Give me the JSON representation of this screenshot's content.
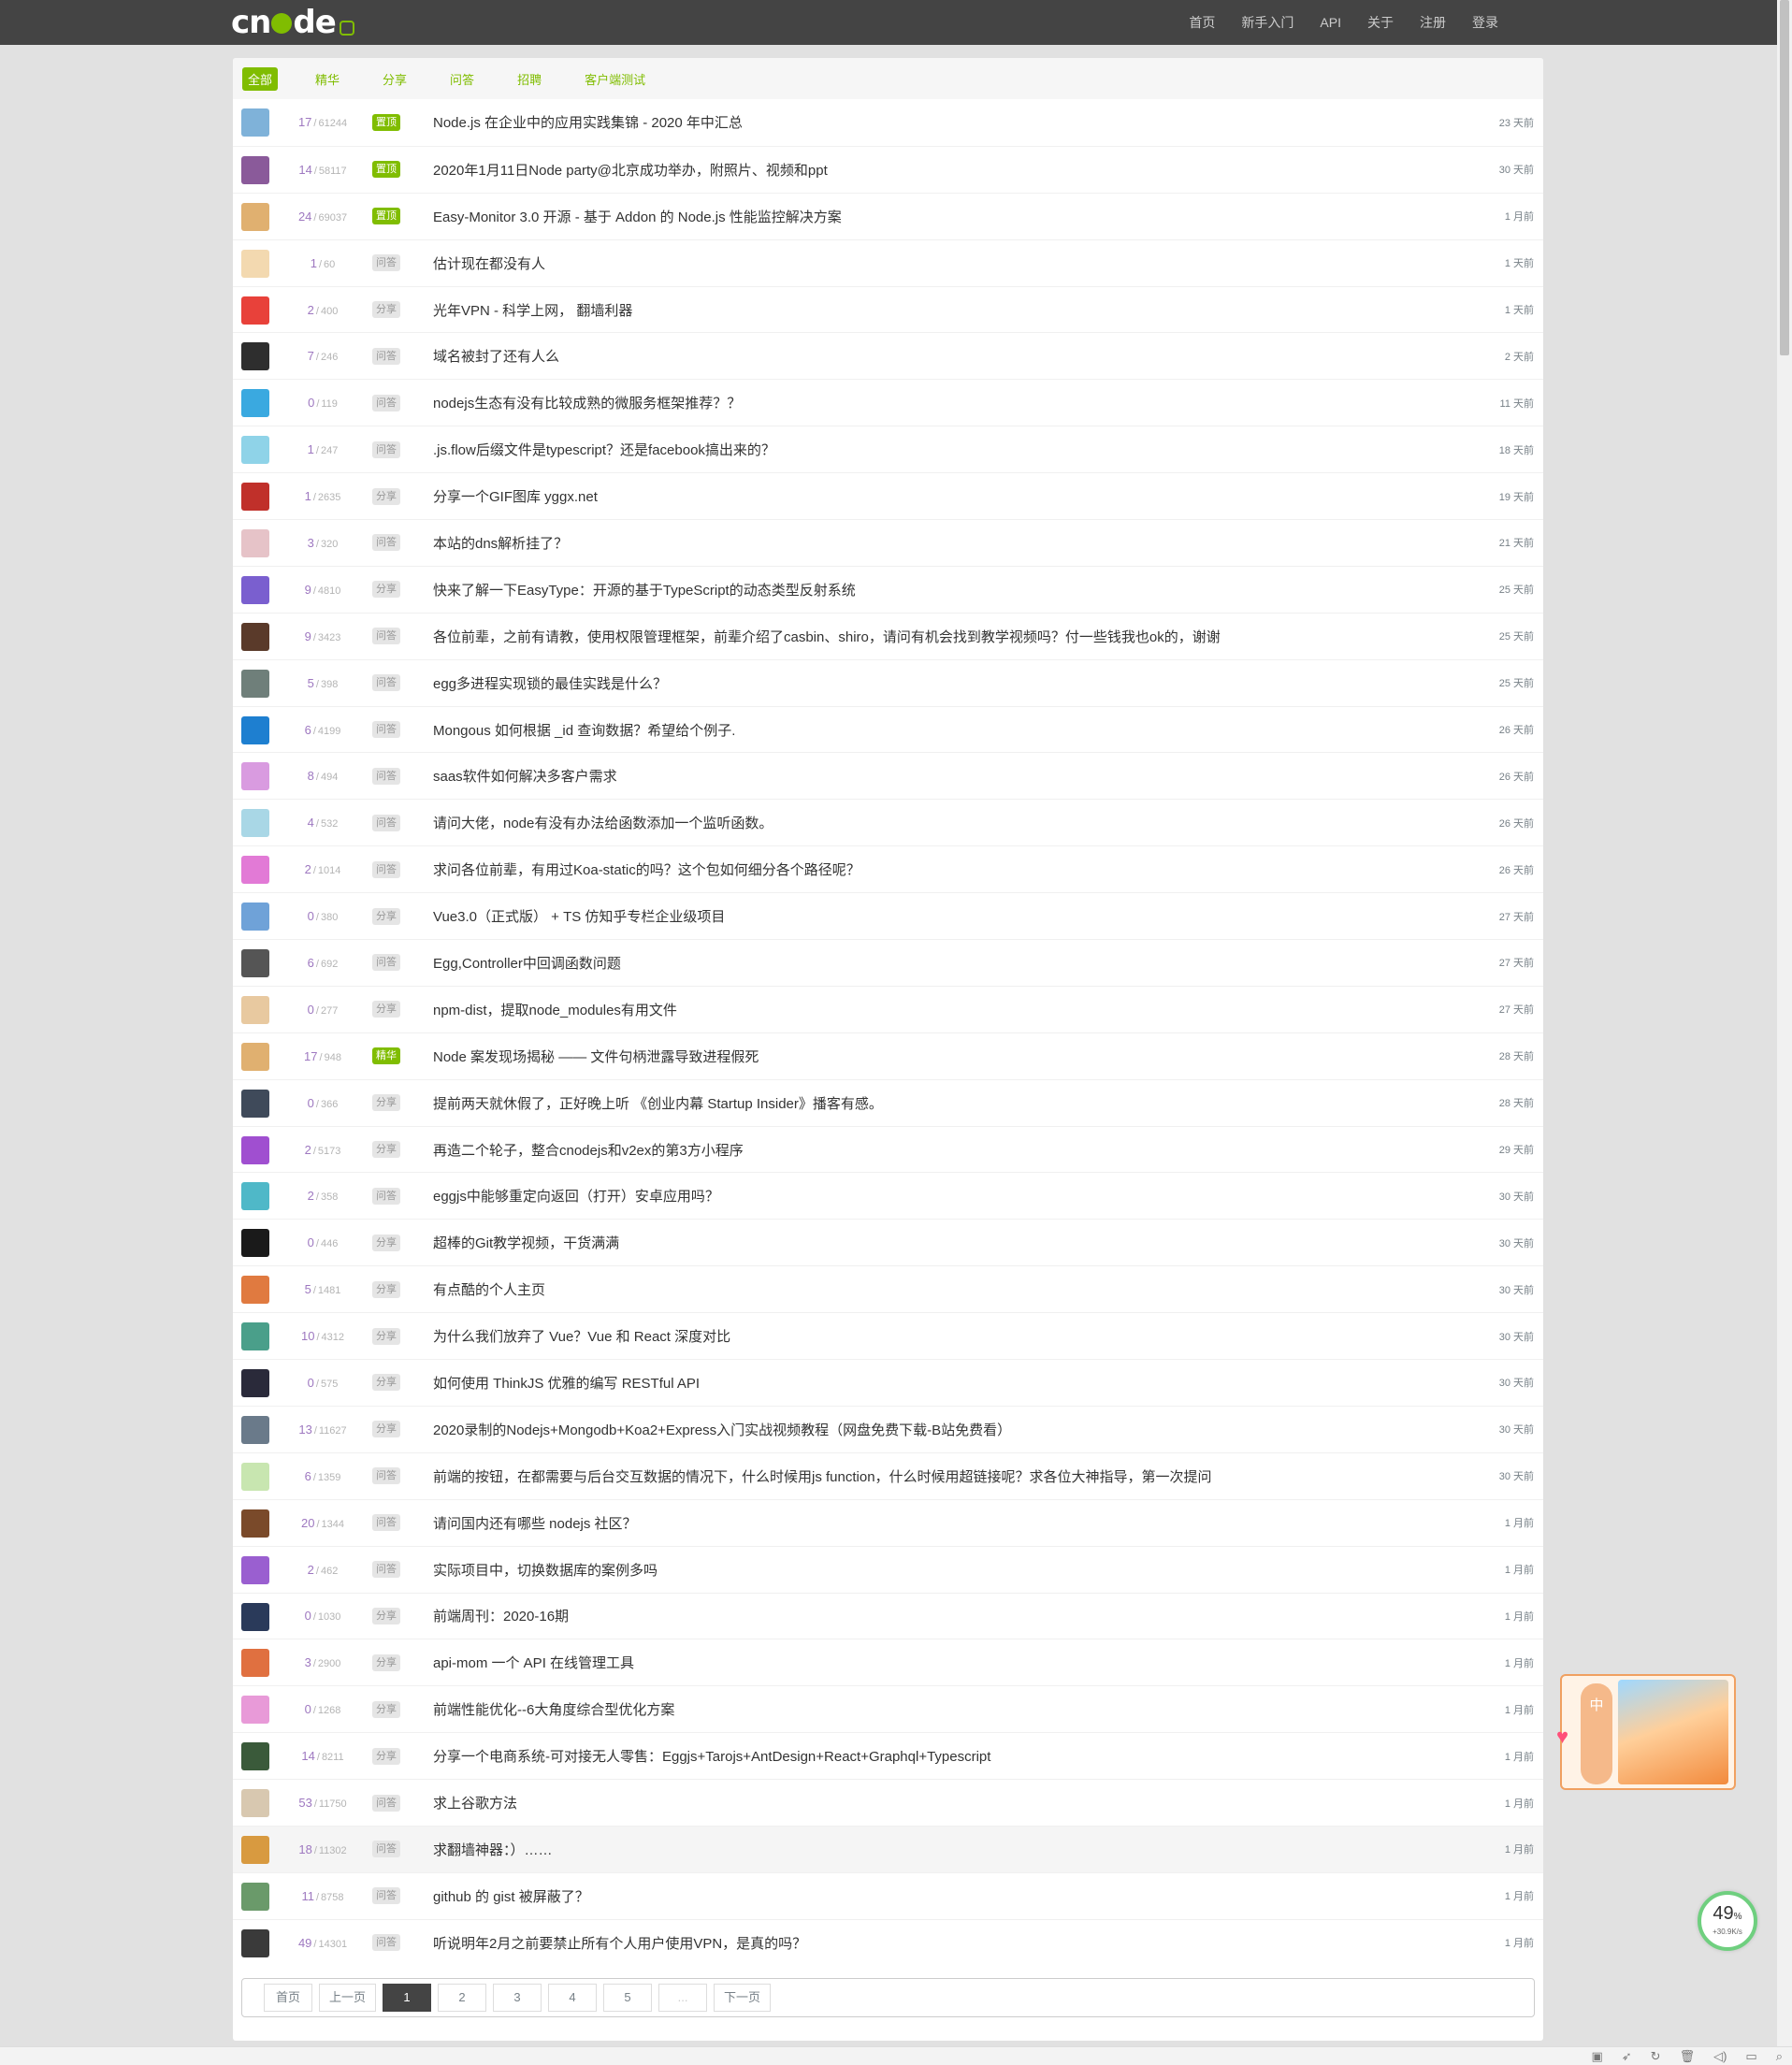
{
  "nav": {
    "brand": "cnode",
    "links": [
      "首页",
      "新手入门",
      "API",
      "关于",
      "注册",
      "登录"
    ]
  },
  "tabs": [
    "全部",
    "精华",
    "分享",
    "问答",
    "招聘",
    "客户端测试"
  ],
  "topics": [
    {
      "replies": "17",
      "visits": "61244",
      "badge": "置顶",
      "badge_type": "top",
      "title": "Node.js 在企业中的应用实践集锦 - 2020 年中汇总",
      "ago": "23 天前",
      "avatar_color": "#7fb2d9"
    },
    {
      "replies": "14",
      "visits": "58117",
      "badge": "置顶",
      "badge_type": "top",
      "title": "2020年1月11日Node party@北京成功举办，附照片、视频和ppt",
      "ago": "30 天前",
      "avatar_color": "#8a5a9a"
    },
    {
      "replies": "24",
      "visits": "69037",
      "badge": "置顶",
      "badge_type": "top",
      "title": "Easy-Monitor 3.0 开源 - 基于 Addon 的 Node.js 性能监控解决方案",
      "ago": "1 月前",
      "avatar_color": "#e0b070"
    },
    {
      "replies": "1",
      "visits": "60",
      "badge": "问答",
      "badge_type": "plain",
      "title": "估计现在都没有人",
      "ago": "1 天前",
      "avatar_color": "#f3d9b0"
    },
    {
      "replies": "2",
      "visits": "400",
      "badge": "分享",
      "badge_type": "plain",
      "title": "光年VPN - 科学上网， 翻墙利器",
      "ago": "1 天前",
      "avatar_color": "#e8413a"
    },
    {
      "replies": "7",
      "visits": "246",
      "badge": "问答",
      "badge_type": "plain",
      "title": "域名被封了还有人么",
      "ago": "2 天前",
      "avatar_color": "#2e2e2e"
    },
    {
      "replies": "0",
      "visits": "119",
      "badge": "问答",
      "badge_type": "plain",
      "title": "nodejs生态有没有比较成熟的微服务框架推荐？？",
      "ago": "11 天前",
      "avatar_color": "#3aa9e0"
    },
    {
      "replies": "1",
      "visits": "247",
      "badge": "问答",
      "badge_type": "plain",
      "title": ".js.flow后缀文件是typescript？还是facebook搞出来的？",
      "ago": "18 天前",
      "avatar_color": "#8fd3e8"
    },
    {
      "replies": "1",
      "visits": "2635",
      "badge": "分享",
      "badge_type": "plain",
      "title": "分享一个GIF图库 yggx.net",
      "ago": "19 天前",
      "avatar_color": "#c0302a"
    },
    {
      "replies": "3",
      "visits": "320",
      "badge": "问答",
      "badge_type": "plain",
      "title": "本站的dns解析挂了？",
      "ago": "21 天前",
      "avatar_color": "#e6c3c8"
    },
    {
      "replies": "9",
      "visits": "4810",
      "badge": "分享",
      "badge_type": "plain",
      "title": "快来了解一下EasyType：开源的基于TypeScript的动态类型反射系统",
      "ago": "25 天前",
      "avatar_color": "#7a5fcf"
    },
    {
      "replies": "9",
      "visits": "3423",
      "badge": "问答",
      "badge_type": "plain",
      "title": "各位前辈，之前有请教，使用权限管理框架，前辈介绍了casbin、shiro，请问有机会找到教学视频吗？付一些钱我也ok的，谢谢",
      "ago": "25 天前",
      "avatar_color": "#5a3a2a"
    },
    {
      "replies": "5",
      "visits": "398",
      "badge": "问答",
      "badge_type": "plain",
      "title": "egg多进程实现锁的最佳实践是什么？",
      "ago": "25 天前",
      "avatar_color": "#6f7f7a"
    },
    {
      "replies": "6",
      "visits": "4199",
      "badge": "问答",
      "badge_type": "plain",
      "title": "Mongous 如何根据 _id 查询数据？希望给个例子.",
      "ago": "26 天前",
      "avatar_color": "#1e7fd0"
    },
    {
      "replies": "8",
      "visits": "494",
      "badge": "问答",
      "badge_type": "plain",
      "title": "saas软件如何解决多客户需求",
      "ago": "26 天前",
      "avatar_color": "#d99be0"
    },
    {
      "replies": "4",
      "visits": "532",
      "badge": "问答",
      "badge_type": "plain",
      "title": "请问大佬，node有没有办法给函数添加一个监听函数。",
      "ago": "26 天前",
      "avatar_color": "#a9d7e6"
    },
    {
      "replies": "2",
      "visits": "1014",
      "badge": "问答",
      "badge_type": "plain",
      "title": "求问各位前辈，有用过Koa-static的吗？这个包如何细分各个路径呢？",
      "ago": "26 天前",
      "avatar_color": "#e27ad6"
    },
    {
      "replies": "0",
      "visits": "380",
      "badge": "分享",
      "badge_type": "plain",
      "title": "Vue3.0（正式版） + TS 仿知乎专栏企业级项目",
      "ago": "27 天前",
      "avatar_color": "#6fa2d8"
    },
    {
      "replies": "6",
      "visits": "692",
      "badge": "问答",
      "badge_type": "plain",
      "title": "Egg,Controller中回调函数问题",
      "ago": "27 天前",
      "avatar_color": "#555555"
    },
    {
      "replies": "0",
      "visits": "277",
      "badge": "分享",
      "badge_type": "plain",
      "title": "npm-dist，提取node_modules有用文件",
      "ago": "27 天前",
      "avatar_color": "#e8c9a0"
    },
    {
      "replies": "17",
      "visits": "948",
      "badge": "精华",
      "badge_type": "top",
      "title": "Node 案发现场揭秘 —— 文件句柄泄露导致进程假死",
      "ago": "28 天前",
      "avatar_color": "#e0b070"
    },
    {
      "replies": "0",
      "visits": "366",
      "badge": "分享",
      "badge_type": "plain",
      "title": "提前两天就休假了，正好晚上听 《创业内幕 Startup Insider》播客有感。",
      "ago": "28 天前",
      "avatar_color": "#3f4a5a"
    },
    {
      "replies": "2",
      "visits": "5173",
      "badge": "分享",
      "badge_type": "plain",
      "title": "再造二个轮子，整合cnodejs和v2ex的第3方小程序",
      "ago": "29 天前",
      "avatar_color": "#a04fd0"
    },
    {
      "replies": "2",
      "visits": "358",
      "badge": "问答",
      "badge_type": "plain",
      "title": "eggjs中能够重定向返回（打开）安卓应用吗？",
      "ago": "30 天前",
      "avatar_color": "#4fb8c8"
    },
    {
      "replies": "0",
      "visits": "446",
      "badge": "分享",
      "badge_type": "plain",
      "title": "超棒的Git教学视频，干货满满",
      "ago": "30 天前",
      "avatar_color": "#1a1a1a"
    },
    {
      "replies": "5",
      "visits": "1481",
      "badge": "分享",
      "badge_type": "plain",
      "title": "有点酷的个人主页",
      "ago": "30 天前",
      "avatar_color": "#e07a40"
    },
    {
      "replies": "10",
      "visits": "4312",
      "badge": "分享",
      "badge_type": "plain",
      "title": "为什么我们放弃了 Vue？Vue 和 React 深度对比",
      "ago": "30 天前",
      "avatar_color": "#4a9f8a"
    },
    {
      "replies": "0",
      "visits": "575",
      "badge": "分享",
      "badge_type": "plain",
      "title": "如何使用 ThinkJS 优雅的编写 RESTful API",
      "ago": "30 天前",
      "avatar_color": "#2a2a3a"
    },
    {
      "replies": "13",
      "visits": "11627",
      "badge": "分享",
      "badge_type": "plain",
      "title": "2020录制的Nodejs+Mongodb+Koa2+Express入门实战视频教程（网盘免费下载-B站免费看）",
      "ago": "30 天前",
      "avatar_color": "#6a7a8a"
    },
    {
      "replies": "6",
      "visits": "1359",
      "badge": "问答",
      "badge_type": "plain",
      "title": "前端的按钮，在都需要与后台交互数据的情况下，什么时候用js function，什么时候用超链接呢？求各位大神指导，第一次提问",
      "ago": "30 天前",
      "avatar_color": "#c8e6b0"
    },
    {
      "replies": "20",
      "visits": "1344",
      "badge": "问答",
      "badge_type": "plain",
      "title": "请问国内还有哪些 nodejs 社区？",
      "ago": "1 月前",
      "avatar_color": "#7a4a2a"
    },
    {
      "replies": "2",
      "visits": "462",
      "badge": "问答",
      "badge_type": "plain",
      "title": "实际项目中，切换数据库的案例多吗",
      "ago": "1 月前",
      "avatar_color": "#9a5fd0"
    },
    {
      "replies": "0",
      "visits": "1030",
      "badge": "分享",
      "badge_type": "plain",
      "title": "前端周刊：2020-16期",
      "ago": "1 月前",
      "avatar_color": "#2a3a5a"
    },
    {
      "replies": "3",
      "visits": "2900",
      "badge": "分享",
      "badge_type": "plain",
      "title": "api-mom 一个 API 在线管理工具",
      "ago": "1 月前",
      "avatar_color": "#e07040"
    },
    {
      "replies": "0",
      "visits": "1268",
      "badge": "分享",
      "badge_type": "plain",
      "title": "前端性能优化--6大角度综合型优化方案",
      "ago": "1 月前",
      "avatar_color": "#e89ad8"
    },
    {
      "replies": "14",
      "visits": "8211",
      "badge": "分享",
      "badge_type": "plain",
      "title": "分享一个电商系统-可对接无人零售：Eggjs+Tarojs+AntDesign+React+Graphql+Typescript",
      "ago": "1 月前",
      "avatar_color": "#3a5a3a"
    },
    {
      "replies": "53",
      "visits": "11750",
      "badge": "问答",
      "badge_type": "plain",
      "title": "求上谷歌方法",
      "ago": "1 月前",
      "avatar_color": "#d8c8b0"
    },
    {
      "replies": "18",
      "visits": "11302",
      "badge": "问答",
      "badge_type": "plain",
      "title": "求翻墙神器：）……",
      "ago": "1 月前",
      "avatar_color": "#d89a40"
    },
    {
      "replies": "11",
      "visits": "8758",
      "badge": "问答",
      "badge_type": "plain",
      "title": "github 的 gist 被屏蔽了？",
      "ago": "1 月前",
      "avatar_color": "#6a9a6a"
    },
    {
      "replies": "49",
      "visits": "14301",
      "badge": "问答",
      "badge_type": "plain",
      "title": "听说明年2月之前要禁止所有个人用户使用VPN，是真的吗？",
      "ago": "1 月前",
      "avatar_color": "#3a3a3a"
    }
  ],
  "pagination": [
    "首页",
    "上一页",
    "1",
    "2",
    "3",
    "4",
    "5",
    "...",
    "下一页"
  ],
  "pagination_active": "1",
  "mascot": {
    "side_label": "中"
  },
  "gauge": {
    "percent": "49",
    "percent_unit": "%",
    "speed": "+30.9K/s",
    "level": 0.49
  },
  "colors": {
    "brand_green": "#80bd01",
    "navbar": "#444444",
    "reply_purple": "#9e78c0"
  },
  "status_icons": [
    "image-icon",
    "rocket-icon",
    "refresh-icon",
    "trash-icon",
    "speaker-icon",
    "window-icon",
    "search-icon"
  ]
}
